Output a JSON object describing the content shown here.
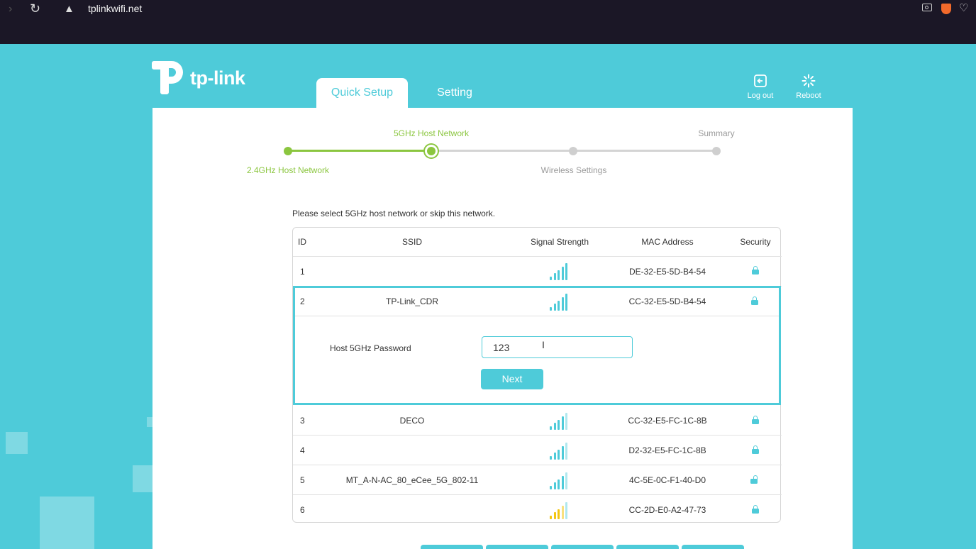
{
  "browser": {
    "url": "tplinkwifi.net",
    "icons": [
      "forward-icon",
      "reload-icon",
      "warning-icon",
      "camera-icon",
      "brave-shield-icon",
      "heart-icon"
    ]
  },
  "header": {
    "logo_text": "tp-link",
    "tabs": [
      {
        "label": "Quick Setup",
        "active": true
      },
      {
        "label": "Setting",
        "active": false
      }
    ],
    "logout_label": "Log out",
    "reboot_label": "Reboot"
  },
  "stepper": {
    "steps": [
      {
        "label": "2.4GHz Host Network",
        "state": "done"
      },
      {
        "label": "5GHz Host Network",
        "state": "current"
      },
      {
        "label": "Wireless Settings",
        "state": "todo"
      },
      {
        "label": "Summary",
        "state": "todo"
      }
    ]
  },
  "instruction": "Please select 5GHz host network or skip this network.",
  "table": {
    "headers": {
      "id": "ID",
      "ssid": "SSID",
      "signal": "Signal Strength",
      "mac": "MAC Address",
      "security": "Security"
    },
    "rows": [
      {
        "id": "1",
        "ssid": "",
        "mac": "DE-32-E5-5D-B4-54",
        "secured": true,
        "signal_color": "#4ecbd9"
      },
      {
        "id": "2",
        "ssid": "TP-Link_CDR",
        "mac": "CC-32-E5-5D-B4-54",
        "secured": true,
        "signal_color": "#4ecbd9"
      },
      {
        "id": "3",
        "ssid": "DECO",
        "mac": "CC-32-E5-FC-1C-8B",
        "secured": true,
        "signal_color": "#4ecbd9"
      },
      {
        "id": "4",
        "ssid": "",
        "mac": "D2-32-E5-FC-1C-8B",
        "secured": true,
        "signal_color": "#4ecbd9"
      },
      {
        "id": "5",
        "ssid": "MT_A-N-AC_80_eCee_5G_802-11",
        "mac": "4C-5E-0C-F1-40-D0",
        "secured": false,
        "signal_color": "#4ecbd9"
      },
      {
        "id": "6",
        "ssid": "",
        "mac": "CC-2D-E0-A2-47-73",
        "secured": true,
        "signal_color": "#f3c613"
      }
    ]
  },
  "expanded": {
    "password_label": "Host 5GHz Password",
    "password_value": "123",
    "next_label": "Next"
  },
  "colors": {
    "accent": "#4ecbd9",
    "progress": "#8bc63f",
    "weak_signal": "#f3c613"
  }
}
